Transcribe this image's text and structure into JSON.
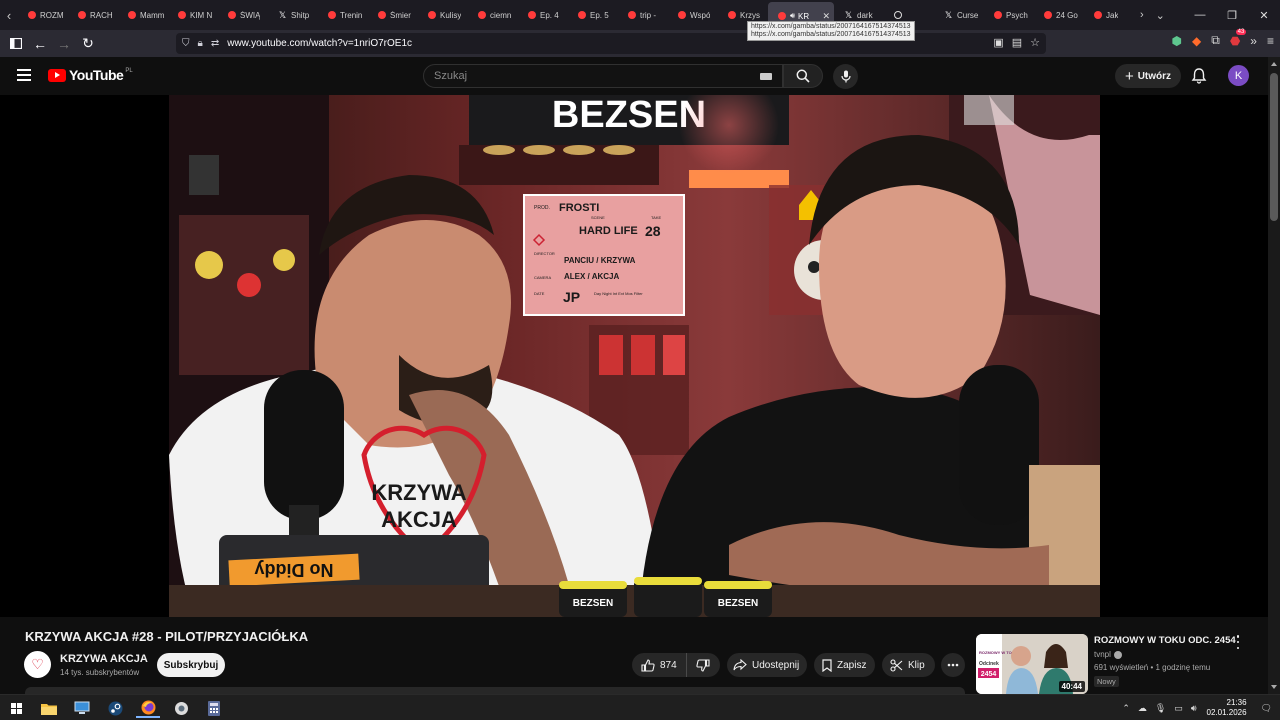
{
  "browser": {
    "tabs": [
      {
        "label": "ROZM",
        "icon": "youtube-favicon"
      },
      {
        "label": "RACH",
        "icon": "youtube-favicon"
      },
      {
        "label": "Mamm",
        "icon": "youtube-favicon"
      },
      {
        "label": "KIM N",
        "icon": "youtube-favicon"
      },
      {
        "label": "ŚWIĄ",
        "icon": "youtube-favicon"
      },
      {
        "label": "Shitp",
        "icon": "x-favicon"
      },
      {
        "label": "Trenin",
        "icon": "youtube-favicon"
      },
      {
        "label": "Śmier",
        "icon": "youtube-favicon"
      },
      {
        "label": "Kulisy",
        "icon": "youtube-favicon"
      },
      {
        "label": "ciemn",
        "icon": "youtube-favicon"
      },
      {
        "label": "Ep. 4",
        "icon": "youtube-favicon"
      },
      {
        "label": "Ep. 5",
        "icon": "youtube-favicon"
      },
      {
        "label": "trip -",
        "icon": "youtube-favicon"
      },
      {
        "label": "Wspó",
        "icon": "youtube-favicon"
      },
      {
        "label": "Krzys",
        "icon": "youtube-favicon"
      },
      {
        "label": "KR",
        "icon": "youtube-favicon",
        "active": true
      },
      {
        "label": "dark",
        "icon": "x-favicon"
      },
      {
        "label": "",
        "icon": "github-favicon"
      },
      {
        "label": "Curse",
        "icon": "x-favicon"
      },
      {
        "label": "Psych",
        "icon": "youtube-favicon"
      },
      {
        "label": "24 Go",
        "icon": "youtube-favicon"
      },
      {
        "label": "Jak",
        "icon": "youtube-favicon"
      }
    ],
    "tooltip": "https://x.com/gamba/status/2007164167514374513",
    "url": "www.youtube.com/watch?v=1nriO7rOE1c",
    "extension_badge": "43"
  },
  "youtube": {
    "logo_text": "YouTube",
    "country": "PL",
    "search_placeholder": "Szukaj",
    "create_label": "Utwórz",
    "avatar_letter": "K"
  },
  "video": {
    "title": "KRZYWA AKCJA #28 - PILOT/PRZYJACIÓŁKA",
    "channel": "KRZYWA AKCJA",
    "subscribers": "14 tys. subskrybentów",
    "subscribe_label": "Subskrybuj",
    "likes": "874",
    "share_label": "Udostępnij",
    "save_label": "Zapisz",
    "clip_label": "Klip",
    "scene": {
      "sign": "BEZSEN",
      "shirt_line1": "KRZYWA",
      "shirt_line2": "AKCJA",
      "sticker": "No Diddy",
      "tins": [
        "BEZSEN",
        "BEZSEN"
      ],
      "clapper": {
        "prod_label": "PROD.",
        "prod": "FROSTI",
        "scene_label": "SCENE",
        "scene_value": "HARD LIFE",
        "take_label": "TAKE",
        "take_value": "28",
        "director_label": "DIRECTOR",
        "director_value": "PANCIU / KRZYWA",
        "camera_label": "CAMERA",
        "camera_value": "ALEX / AKCJA",
        "date_label": "DATE",
        "date_value": "JP",
        "meta": "Day Night Int Ext Mos Filter"
      }
    }
  },
  "recommended": {
    "title": "ROZMOWY W TOKU ODC. 2454",
    "channel": "tvnpl",
    "meta": "691 wyświetleń • 1 godzinę temu",
    "badge": "Nowy",
    "duration": "40:44",
    "thumb_logo": "ROZMOWY W TOKU",
    "thumb_label": "Odcinek",
    "thumb_number": "2454"
  },
  "taskbar": {
    "time": "21:36",
    "date": "02.01.2026"
  }
}
